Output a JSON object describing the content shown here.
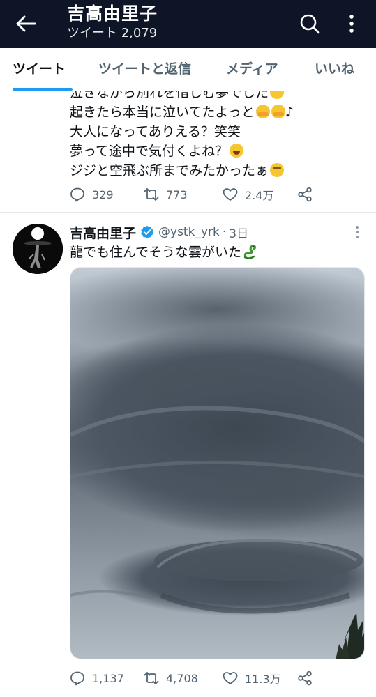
{
  "header": {
    "title": "吉高由里子",
    "subtitle": "ツイート 2,079"
  },
  "tabs": [
    {
      "label": "ツイート",
      "active": true
    },
    {
      "label": "ツイートと返信",
      "active": false
    },
    {
      "label": "メディア",
      "active": false
    },
    {
      "label": "いいね",
      "active": false
    }
  ],
  "tweet1": {
    "lines": [
      "泣きながら別れを惜しむ夢でした",
      "起きたら本当に泣いてたよっと",
      "大人になってありえる？笑笑",
      "夢って途中で気付くよね？",
      "ジジと空飛ぶ所までみたかったぁ"
    ],
    "line2_suffix": "♪",
    "replies": "329",
    "retweets": "773",
    "likes": "2.4万"
  },
  "tweet2": {
    "author": "吉高由里子",
    "handle": "@ystk_yrk",
    "separator": "·",
    "time": "3日",
    "text": "龍でも住んでそうな雲がいた",
    "replies": "1,137",
    "retweets": "4,708",
    "likes": "11.3万"
  },
  "colors": {
    "header_bg": "#0d1526",
    "accent": "#1d9bf0",
    "secondary_text": "#536471",
    "verified": "#1d9bf0"
  },
  "icons": [
    "back-arrow-icon",
    "search-icon",
    "more-vertical-icon",
    "reply-icon",
    "retweet-icon",
    "like-icon",
    "share-icon",
    "verified-badge-icon",
    "kebab-icon"
  ]
}
